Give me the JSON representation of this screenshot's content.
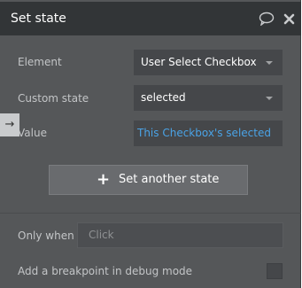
{
  "header": {
    "title": "Set state",
    "comment_icon": "comment-icon",
    "close_icon": "close-icon"
  },
  "fields": {
    "element": {
      "label": "Element",
      "value": "User Select Checkbox"
    },
    "custom_state": {
      "label": "Custom state",
      "value": "selected"
    },
    "value": {
      "label": "Value",
      "value": "This Checkbox's selected"
    }
  },
  "side_tab": {
    "glyph": "→"
  },
  "add_button": {
    "icon": "+",
    "label": "Set another state"
  },
  "only_when": {
    "label": "Only when",
    "placeholder": "Click"
  },
  "breakpoint": {
    "label": "Add a breakpoint in debug mode",
    "checked": false
  },
  "colors": {
    "panel": "#555759",
    "header": "#323537",
    "expression": "#4aa3e6"
  }
}
